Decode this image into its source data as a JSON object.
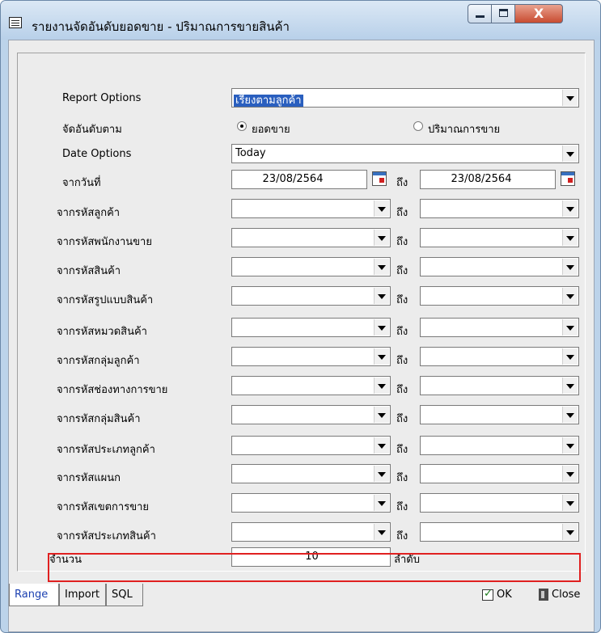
{
  "window": {
    "title": "รายงานจัดอันดับยอดขาย - ปริมาณการขายสินค้า",
    "close_glyph": "X"
  },
  "report_options": {
    "label": "Report Options",
    "value": "เรียงตามลูกค้า"
  },
  "rank_by": {
    "label": "จัดอันดับตาม",
    "option_sales": "ยอดขาย",
    "option_quantity": "ปริมาณการขาย",
    "selected": "ยอดขาย"
  },
  "date_options": {
    "label": "Date Options",
    "value": "Today"
  },
  "date_range": {
    "label": "จากวันที่",
    "from": "23/08/2564",
    "to_label": "ถึง",
    "to": "23/08/2564"
  },
  "ranges": [
    {
      "label": "จากรหัสลูกค้า",
      "to_label": "ถึง"
    },
    {
      "label": "จากรหัสพนักงานขาย",
      "to_label": "ถึง"
    },
    {
      "label": "จากรหัสสินค้า",
      "to_label": "ถึง"
    },
    {
      "label": "จากรหัสรูปแบบสินค้า",
      "to_label": "ถึง"
    },
    {
      "label": "จากรหัสหมวดสินค้า",
      "to_label": "ถึง"
    },
    {
      "label": "จากรหัสกลุ่มลูกค้า",
      "to_label": "ถึง"
    },
    {
      "label": "จากรหัสช่องทางการขาย",
      "to_label": "ถึง"
    },
    {
      "label": "จากรหัสกลุ่มสินค้า",
      "to_label": "ถึง"
    },
    {
      "label": "จากรหัสประเภทลูกค้า",
      "to_label": "ถึง"
    },
    {
      "label": "จากรหัสแผนก",
      "to_label": "ถึง"
    },
    {
      "label": "จากรหัสเขตการขาย",
      "to_label": "ถึง"
    },
    {
      "label": "จากรหัสประเภทสินค้า",
      "to_label": "ถึง"
    }
  ],
  "count": {
    "label": "จำนวน",
    "value": "10",
    "unit": "ลำดับ"
  },
  "tabs": [
    "Range",
    "Import",
    "SQL"
  ],
  "buttons": {
    "ok": "OK",
    "close": "Close"
  }
}
